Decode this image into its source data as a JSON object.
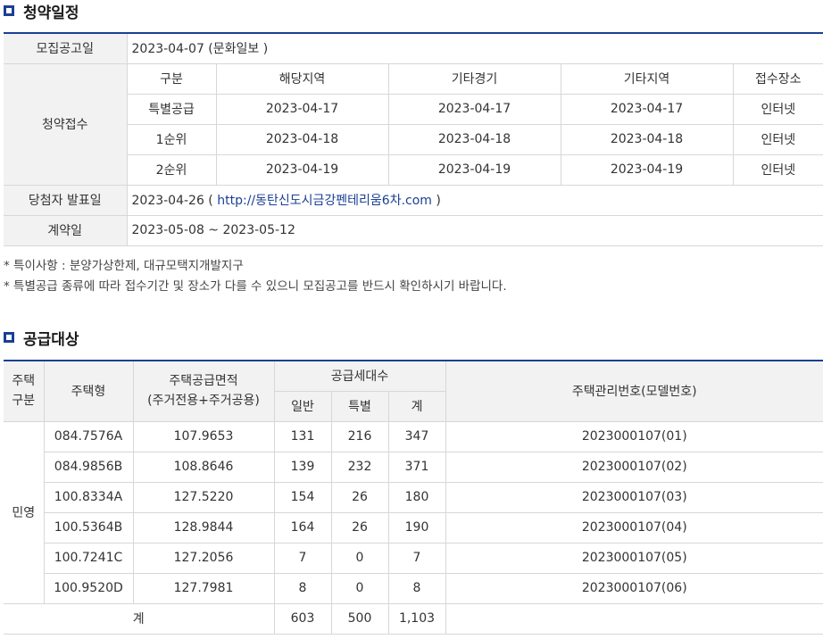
{
  "schedule": {
    "title": "청약일정",
    "announce_label": "모집공고일",
    "announce_value": "2023-04-07 (문화일보 )",
    "apply_label": "청약접수",
    "headers": [
      "구분",
      "해당지역",
      "기타경기",
      "기타지역",
      "접수장소"
    ],
    "rows": [
      [
        "특별공급",
        "2023-04-17",
        "2023-04-17",
        "2023-04-17",
        "인터넷"
      ],
      [
        "1순위",
        "2023-04-18",
        "2023-04-18",
        "2023-04-18",
        "인터넷"
      ],
      [
        "2순위",
        "2023-04-19",
        "2023-04-19",
        "2023-04-19",
        "인터넷"
      ]
    ],
    "winner_label": "당첨자 발표일",
    "winner_date": "2023-04-26 (",
    "winner_link": "http://동탄신도시금강펜테리움6차.com",
    "winner_close": ")",
    "contract_label": "계약일",
    "contract_value": "2023-05-08 ~ 2023-05-12"
  },
  "notes": [
    "* 특이사항 : 분양가상한제, 대규모택지개발지구",
    "* 특별공급 종류에 따라 접수기간 및 장소가 다를 수 있으니 모집공고를 반드시 확인하시기 바랍니다."
  ],
  "supply": {
    "title": "공급대상",
    "headers": {
      "category": "주택\n구분",
      "type": "주택형",
      "area_line1": "주택공급면적",
      "area_line2": "(주거전용+주거공용)",
      "households": "공급세대수",
      "general": "일반",
      "special": "특별",
      "total": "계",
      "mgmt": "주택관리번호(모델번호)"
    },
    "category_value": "민영",
    "rows": [
      [
        "084.7576A",
        "107.9653",
        "131",
        "216",
        "347",
        "2023000107(01)"
      ],
      [
        "084.9856B",
        "108.8646",
        "139",
        "232",
        "371",
        "2023000107(02)"
      ],
      [
        "100.8334A",
        "127.5220",
        "154",
        "26",
        "180",
        "2023000107(03)"
      ],
      [
        "100.5364B",
        "128.9844",
        "164",
        "26",
        "190",
        "2023000107(04)"
      ],
      [
        "100.7241C",
        "127.2056",
        "7",
        "0",
        "7",
        "2023000107(05)"
      ],
      [
        "100.9520D",
        "127.7981",
        "8",
        "0",
        "8",
        "2023000107(06)"
      ]
    ],
    "total_label": "계",
    "totals": [
      "603",
      "500",
      "1,103"
    ]
  },
  "colors": {
    "accent": "#1c3f94",
    "header_bg": "#f2f2f2",
    "border": "#d7d7d7"
  }
}
